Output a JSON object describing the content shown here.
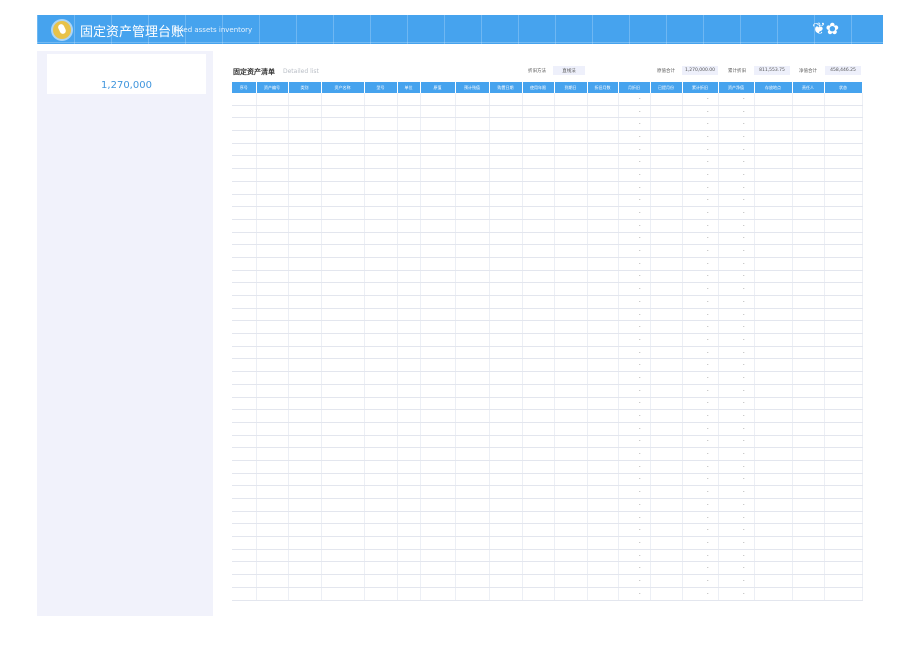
{
  "app": {
    "title": "固定资产管理台账",
    "subtitle": "Fixed assets inventory"
  },
  "sidebar": {
    "total_value": "1,270,000"
  },
  "list": {
    "title": "固定资产清单",
    "subtitle": "Detailed list",
    "depreciation_method_label": "折旧方法",
    "depreciation_method_value": "直线法",
    "original_total_label": "原值合计",
    "original_total_value": "1,270,000.00",
    "accumulated_label": "累计折旧",
    "accumulated_value": "811,553.75",
    "net_total_label": "净值合计",
    "net_total_value": "458,446.25"
  },
  "table": {
    "columns": [
      "序号",
      "资产编号",
      "类别",
      "资产名称",
      "型号",
      "单位",
      "原值",
      "预计残值",
      "购置日期",
      "使用年限",
      "到期日",
      "折旧月数",
      "月折旧",
      "已提月份",
      "累计折旧",
      "资产净值",
      "存放地点",
      "责任人",
      "状态"
    ],
    "placeholder": "-",
    "row_count": 40
  }
}
